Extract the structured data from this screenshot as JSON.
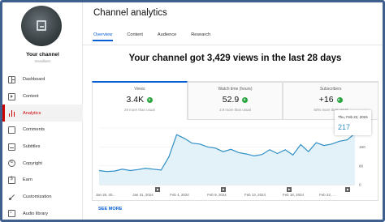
{
  "sidebar": {
    "channel_name": "Your channel",
    "channel_handle": "Insedbarn",
    "items": [
      {
        "label": "Dashboard",
        "icon": "dashboard-icon"
      },
      {
        "label": "Content",
        "icon": "content-icon"
      },
      {
        "label": "Analytics",
        "icon": "analytics-icon",
        "active": true
      },
      {
        "label": "Comments",
        "icon": "comments-icon"
      },
      {
        "label": "Subtitles",
        "icon": "subtitles-icon"
      },
      {
        "label": "Copyright",
        "icon": "copyright-icon"
      },
      {
        "label": "Earn",
        "icon": "earn-icon"
      },
      {
        "label": "Customization",
        "icon": "customization-icon"
      },
      {
        "label": "Audio library",
        "icon": "audio-library-icon"
      }
    ]
  },
  "header": {
    "title": "Channel analytics",
    "tabs": [
      {
        "label": "Overview",
        "active": true
      },
      {
        "label": "Content"
      },
      {
        "label": "Audience"
      },
      {
        "label": "Research"
      }
    ]
  },
  "headline": "Your channel got 3,429 views in the last 28 days",
  "cards": [
    {
      "label": "Views",
      "value": "3.4K",
      "note": "29 more than usual",
      "active": true
    },
    {
      "label": "Watch time (hours)",
      "value": "52.9",
      "note": "2.9 more than usual"
    },
    {
      "label": "Subscribers",
      "value": "+16",
      "note": "60% more than usual"
    }
  ],
  "tooltip": {
    "date": "Thu, Feb 22, 2024",
    "value": "217"
  },
  "see_more": "SEE MORE",
  "colors": {
    "accent_blue": "#065fd4",
    "active_red": "#cc0000",
    "line": "#2f8fc6",
    "area": "#e3f1f9",
    "up_green": "#2ba640"
  },
  "chart_data": {
    "type": "area",
    "series": [
      {
        "name": "Views",
        "values": [
          60,
          56,
          58,
          66,
          60,
          64,
          70,
          66,
          62,
          118,
          212,
          196,
          176,
          172,
          160,
          155,
          140,
          150,
          136,
          130,
          122,
          128,
          148,
          132,
          148,
          126,
          170,
          140,
          178,
          166,
          172,
          184,
          190,
          217
        ]
      }
    ],
    "x_tick_labels": [
      "Jan 26, 20...",
      "Jan 31, 2024",
      "Feb 4, 2024",
      "Feb 9, 2024",
      "Feb 13, 2024",
      "Feb 18, 2024",
      "Feb 22, ..."
    ],
    "y_tick_labels": [
      "240",
      "160",
      "80",
      "0"
    ],
    "ylim": [
      0,
      240
    ],
    "grid": true,
    "markers": 4
  }
}
